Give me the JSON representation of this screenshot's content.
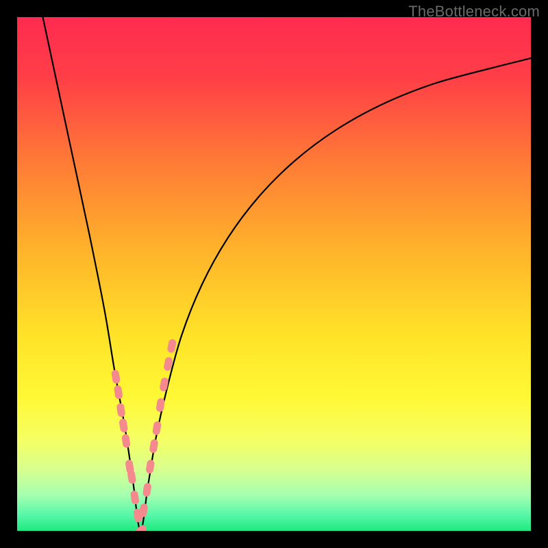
{
  "watermark": "TheBottleneck.com",
  "colors": {
    "gradient_stops": [
      {
        "offset": 0.0,
        "color": "#ff2b50"
      },
      {
        "offset": 0.12,
        "color": "#ff3f47"
      },
      {
        "offset": 0.28,
        "color": "#ff7a36"
      },
      {
        "offset": 0.45,
        "color": "#ffb22b"
      },
      {
        "offset": 0.62,
        "color": "#ffe328"
      },
      {
        "offset": 0.74,
        "color": "#fff835"
      },
      {
        "offset": 0.82,
        "color": "#f6ff62"
      },
      {
        "offset": 0.88,
        "color": "#d8ff8e"
      },
      {
        "offset": 0.93,
        "color": "#a6ffb0"
      },
      {
        "offset": 0.97,
        "color": "#55f7a8"
      },
      {
        "offset": 1.0,
        "color": "#1fe97f"
      }
    ],
    "curve": "#000000",
    "marker": "#f58a8e",
    "frame": "#000000"
  },
  "chart_data": {
    "type": "line",
    "title": "",
    "xlabel": "",
    "ylabel": "",
    "xlim": [
      0,
      100
    ],
    "ylim": [
      0,
      100
    ],
    "x_min_at": 24,
    "series": [
      {
        "name": "bottleneck-curve",
        "x": [
          5,
          8,
          11,
          14,
          17,
          19,
          21,
          22.5,
          24,
          25.5,
          27,
          29,
          32,
          36,
          41,
          47,
          54,
          62,
          71,
          81,
          92,
          100
        ],
        "values": [
          100,
          86,
          72,
          58,
          43,
          31,
          20,
          10,
          0,
          9,
          18,
          27,
          38,
          48,
          57,
          65,
          72,
          78,
          83,
          87,
          90,
          92
        ]
      }
    ],
    "markers": {
      "name": "sample-points",
      "x": [
        19.2,
        19.7,
        20.2,
        20.7,
        21.2,
        21.9,
        22.3,
        22.9,
        23.5,
        24.0,
        24.6,
        25.3,
        25.9,
        26.6,
        27.2,
        27.9,
        28.6,
        29.4,
        30.1
      ],
      "values": [
        30.0,
        27.0,
        23.5,
        20.5,
        17.5,
        12.5,
        10.5,
        6.5,
        3.0,
        0.0,
        4.0,
        8.0,
        12.5,
        16.5,
        20.0,
        24.5,
        28.5,
        32.5,
        36.0
      ]
    }
  }
}
